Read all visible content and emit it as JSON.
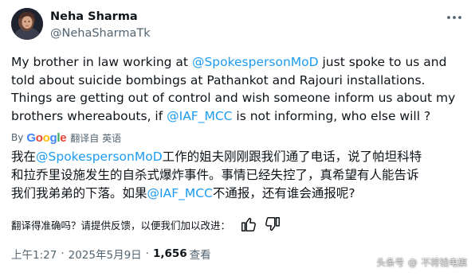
{
  "author": {
    "name": "Neha Sharma",
    "handle": "@NehaSharmaTk"
  },
  "tweet": {
    "lines": [
      {
        "pre": "My brother in law working at ",
        "mention": "@SpokespersonMoD",
        "post": " just spoke to us and"
      },
      {
        "pre": "told about suicide bombings at Pathankot and Rajouri installations.",
        "mention": "",
        "post": ""
      },
      {
        "pre": "Things  are getting out of control and wish someone inform us about my",
        "mention": "",
        "post": ""
      },
      {
        "pre": "brothers whereabouts, if ",
        "mention": "@IAF_MCC",
        "post": " is not informing, who else will ?"
      }
    ]
  },
  "translation": {
    "by_label": "By",
    "google_label": "Google",
    "translated_from": "翻译自 英语",
    "lines": [
      {
        "pre": "我在",
        "mention": "@SpokespersonMoD",
        "post": "工作的姐夫刚刚跟我们通了电话，说了帕坦科特"
      },
      {
        "pre": "和拉乔里设施发生的自杀式爆炸事件。事情已经失控了，真希望有人能告诉",
        "mention": "",
        "post": ""
      },
      {
        "pre": "我们我弟弟的下落。如果",
        "mention": "@IAF_MCC",
        "post": "不通报，还有谁会通报呢?"
      }
    ],
    "feedback_prompt": "翻译得准确吗？请提供反馈，以便我们加以改进："
  },
  "meta": {
    "time": "上午1:27",
    "date": "2025年5月9日",
    "views_count": "1,656",
    "views_label": "查看"
  },
  "watermark": {
    "source": "头条号",
    "author": "不将钱电旗"
  },
  "icons": {
    "more": "more-horizontal-icon",
    "thumbs_up": "thumbs-up-icon",
    "thumbs_down": "thumbs-down-icon"
  },
  "colors": {
    "link": "#1d9bf0",
    "text": "#0f1419",
    "secondary": "#536471",
    "google_blue": "#4285F4",
    "google_red": "#EA4335",
    "google_yellow": "#FBBC05",
    "google_green": "#34A853"
  }
}
